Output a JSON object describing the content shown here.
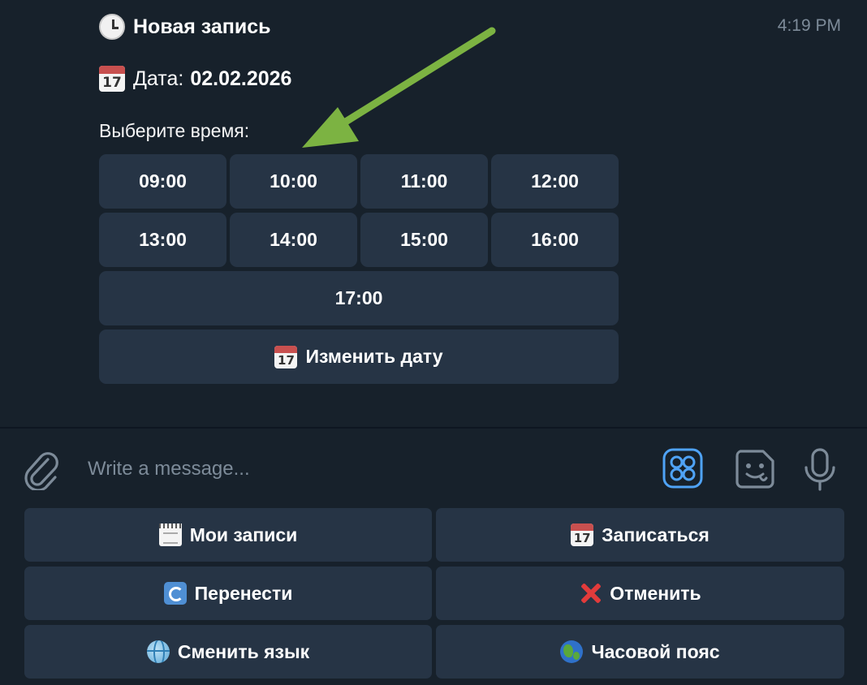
{
  "message": {
    "title": "Новая запись",
    "time": "4:19 PM",
    "date_label": "Дата:",
    "date_value": "02.02.2026",
    "prompt": "Выберите время:",
    "calendar_day": "17"
  },
  "inline_keyboard": {
    "times": [
      "09:00",
      "10:00",
      "11:00",
      "12:00",
      "13:00",
      "14:00",
      "15:00",
      "16:00",
      "17:00"
    ],
    "change_date": "Изменить дату"
  },
  "input": {
    "placeholder": "Write a message..."
  },
  "reply_keyboard": {
    "my_bookings": "Мои записи",
    "book": "Записаться",
    "reschedule": "Перенести",
    "cancel": "Отменить",
    "change_language": "Сменить язык",
    "timezone": "Часовой пояс"
  },
  "colors": {
    "background": "#17212b",
    "button": "#263445",
    "accent": "#4fa3f7",
    "annotation_arrow": "#7cb342",
    "muted_text": "#7d8b99"
  },
  "icons": {
    "title": "clock-icon",
    "date": "calendar-icon",
    "attach": "paperclip-icon",
    "commands": "bot-commands-icon",
    "sticker": "sticker-icon",
    "voice": "microphone-icon"
  }
}
